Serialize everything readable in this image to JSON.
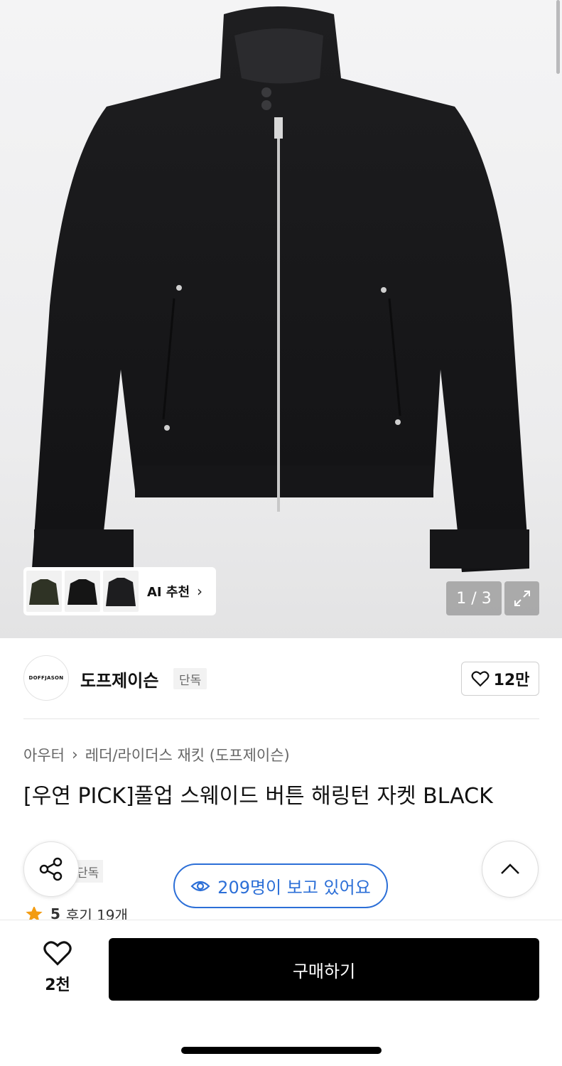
{
  "image": {
    "counter": "1 / 3",
    "ai_recommend_label": "AI 추천",
    "thumbnails": [
      "jacket-green-thumb",
      "jacket-black-thumb",
      "jacket-dark-thumb"
    ]
  },
  "brand": {
    "logo_text": "DOFFJASON",
    "name": "도프제이슨",
    "badge": "단독",
    "like_count": "12만"
  },
  "breadcrumb": {
    "category": "아우터",
    "subcategory": "레더/라이더스 재킷 (도프제이슨)"
  },
  "product": {
    "title": "[우연 PICK]풀업 스웨이드 버튼 해링턴 자켓 BLACK",
    "badge": "단독",
    "viewers": "209명이 보고 있어요",
    "rating": "5",
    "reviews": "후기 19개"
  },
  "bottom_bar": {
    "wish_count": "2천",
    "buy_label": "구매하기"
  },
  "colors": {
    "accent_blue": "#2c6fd7",
    "star": "#f39c12",
    "buy_bg": "#000000"
  }
}
